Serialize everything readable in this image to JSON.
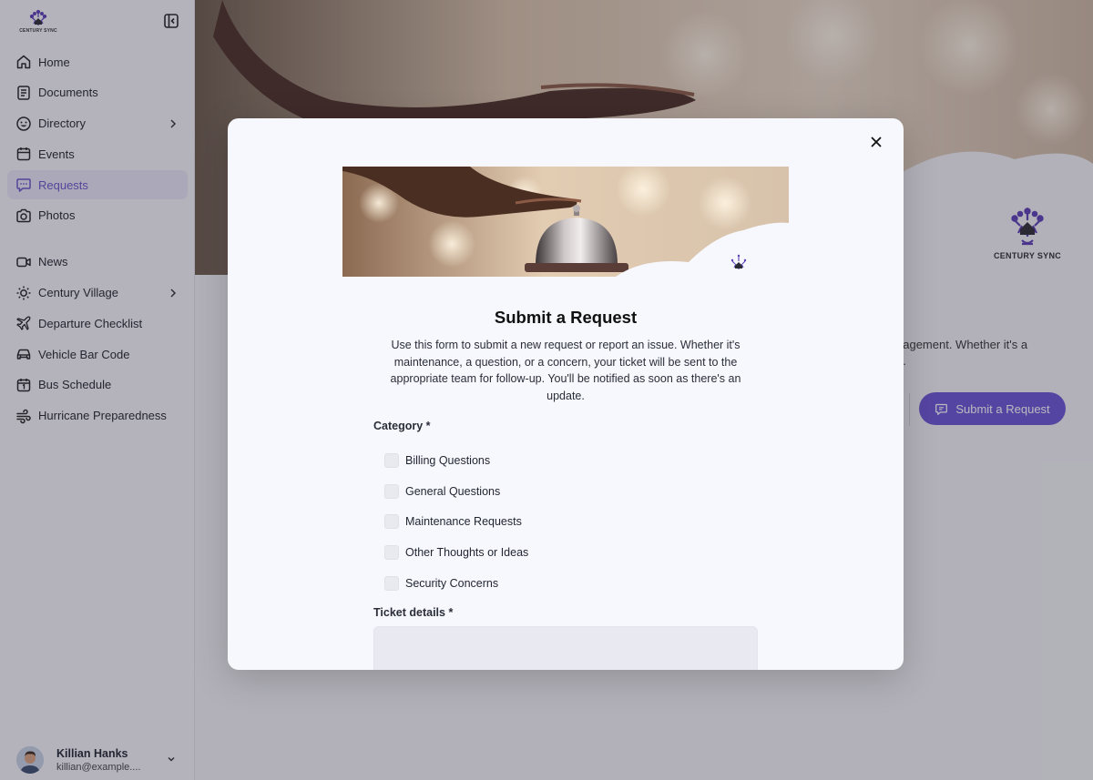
{
  "app": {
    "brand_label": "CENTURY SYNC",
    "accent": "#6a55d4"
  },
  "sidebar": {
    "items": [
      {
        "label": "Home",
        "icon": "home-icon"
      },
      {
        "label": "Documents",
        "icon": "document-icon"
      },
      {
        "label": "Directory",
        "icon": "smile-icon",
        "has_submenu": true
      },
      {
        "label": "Events",
        "icon": "calendar-icon"
      },
      {
        "label": "Requests",
        "icon": "message-icon",
        "active": true
      },
      {
        "label": "Photos",
        "icon": "camera-icon"
      },
      {
        "label": "News",
        "icon": "video-icon"
      },
      {
        "label": "Century Village",
        "icon": "sun-icon",
        "has_submenu": true
      },
      {
        "label": "Departure Checklist",
        "icon": "plane-icon"
      },
      {
        "label": "Vehicle Bar Code",
        "icon": "car-icon"
      },
      {
        "label": "Bus Schedule",
        "icon": "calendar-day-icon"
      },
      {
        "label": "Hurricane Preparedness",
        "icon": "wind-icon"
      }
    ]
  },
  "user": {
    "name": "Killian Hanks",
    "email": "killian@example...."
  },
  "background_page": {
    "text_line1": "nagement. Whether it's a",
    "text_line2": "e.",
    "submit_label": "Submit a Request",
    "logo_label": "CENTURY SYNC"
  },
  "modal": {
    "title": "Submit a Request",
    "description": "Use this form to submit a new request or report an issue. Whether it's maintenance, a question, or a concern, your ticket will be sent to the appropriate team for follow-up. You'll be notified as soon as there's an update.",
    "category_label": "Category *",
    "categories": [
      "Billing Questions",
      "General Questions",
      "Maintenance Requests",
      "Other Thoughts or Ideas",
      "Security Concerns"
    ],
    "ticket_label": "Ticket details *",
    "ticket_value": ""
  }
}
